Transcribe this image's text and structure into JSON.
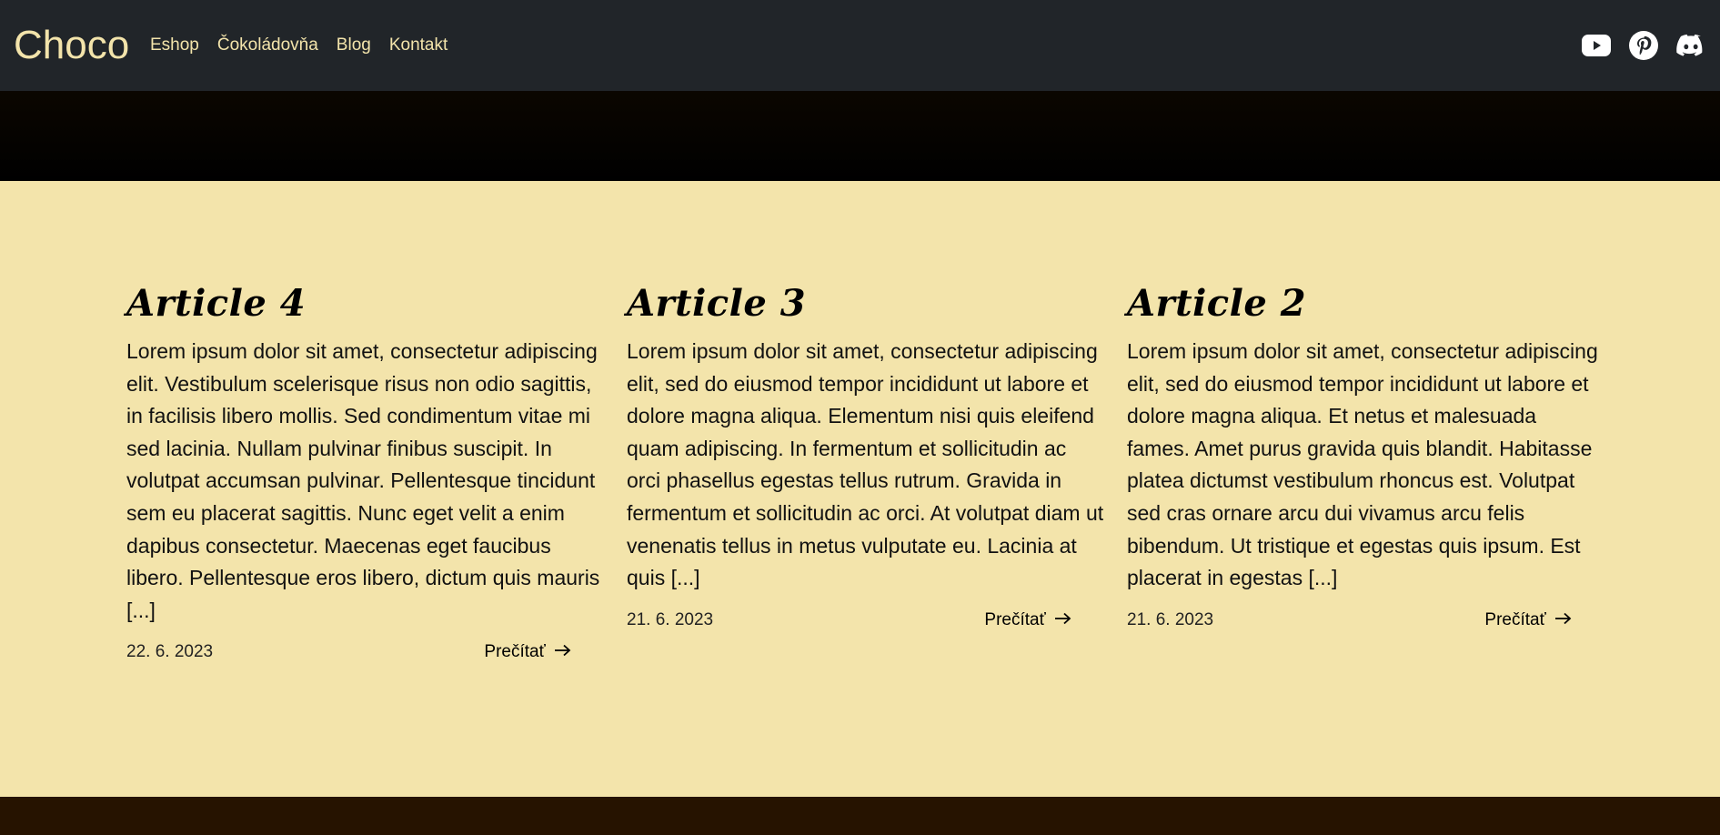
{
  "brand": "Choco",
  "nav": [
    "Eshop",
    "Čokoládovňa",
    "Blog",
    "Kontakt"
  ],
  "social": [
    "youtube-icon",
    "pinterest-icon",
    "discord-icon"
  ],
  "colors": {
    "navbar": "#212529",
    "accent": "#f3e4ab",
    "background": "#f3e4ab",
    "footer": "#261300"
  },
  "articles": [
    {
      "title": "Article 4",
      "text": "Lorem ipsum dolor sit amet, consectetur adipiscing elit. Vestibulum scelerisque risus non odio sagittis, in facilisis libero mollis. Sed condimentum vitae mi sed lacinia. Nullam pulvinar finibus suscipit. In volutpat accumsan pulvinar. Pellentesque tincidunt sem eu placerat sagittis. Nunc eget velit a enim dapibus consectetur. Maecenas eget faucibus libero. Pellentesque eros libero, dictum quis mauris [...]",
      "date": "22. 6. 2023",
      "read_more": "Prečítať"
    },
    {
      "title": "Article 3",
      "text": "Lorem ipsum dolor sit amet, consectetur adipiscing elit, sed do eiusmod tempor incididunt ut labore et dolore magna aliqua. Elementum nisi quis eleifend quam adipiscing. In fermentum et sollicitudin ac orci phasellus egestas tellus rutrum. Gravida in fermentum et sollicitudin ac orci. At volutpat diam ut venenatis tellus in metus vulputate eu. Lacinia at quis [...]",
      "date": "21. 6. 2023",
      "read_more": "Prečítať"
    },
    {
      "title": "Article 2",
      "text": "Lorem ipsum dolor sit amet, consectetur adipiscing elit, sed do eiusmod tempor incididunt ut labore et dolore magna aliqua. Et netus et malesuada fames. Amet purus gravida quis blandit. Habitasse platea dictumst vestibulum rhoncus est. Volutpat sed cras ornare arcu dui vivamus arcu felis bibendum. Ut tristique et egestas quis ipsum. Est placerat in egestas [...]",
      "date": "21. 6. 2023",
      "read_more": "Prečítať"
    }
  ]
}
